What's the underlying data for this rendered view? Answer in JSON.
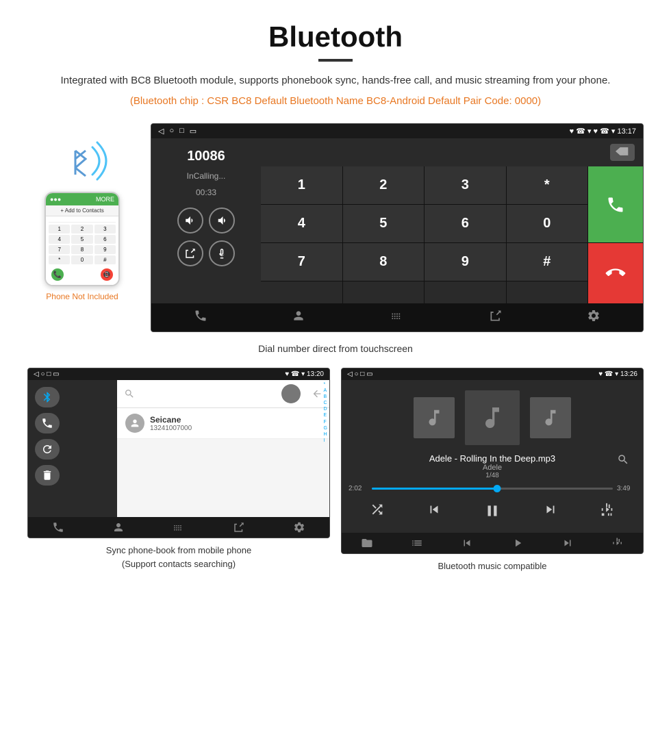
{
  "page": {
    "title": "Bluetooth",
    "underline": true,
    "description": "Integrated with BC8 Bluetooth module, supports phonebook sync, hands-free call, and music streaming from your phone.",
    "orange_info": "(Bluetooth chip : CSR BC8    Default Bluetooth Name BC8-Android    Default Pair Code: 0000)"
  },
  "phone_illustration": {
    "not_included_label": "Phone Not Included"
  },
  "android_screen": {
    "status_bar": {
      "left_icons": "◁  ○  □  ▭",
      "right": "♥ ☎ ▾ 13:17"
    },
    "call": {
      "number": "10086",
      "status": "InCalling...",
      "timer": "00:33"
    },
    "numpad": {
      "display_number": "10086",
      "keys": [
        "1",
        "2",
        "3",
        "*",
        "4",
        "5",
        "6",
        "0",
        "7",
        "8",
        "9",
        "#"
      ]
    }
  },
  "caption_dial": "Dial number direct from touchscreen",
  "phonebook_screen": {
    "status_bar": {
      "left": "◁  ○  □  ▭",
      "right": "♥ ☎ ▾ 13:20"
    },
    "contact_name": "Seicane",
    "contact_number": "13241007000",
    "alphabet": [
      "*",
      "A",
      "B",
      "C",
      "D",
      "E",
      "F",
      "G",
      "H",
      "I"
    ],
    "search_placeholder": "Search"
  },
  "music_screen": {
    "status_bar": {
      "left": "◁  ○  □  ▭",
      "right": "♥ ☎ ▾ 13:26"
    },
    "song_title": "Adele - Rolling In the Deep.mp3",
    "artist": "Adele",
    "track_num": "1/48",
    "time_current": "2:02",
    "time_total": "3:49",
    "progress_percent": 52
  },
  "captions": {
    "phonebook": "Sync phone-book from mobile phone\n(Support contacts searching)",
    "music": "Bluetooth music compatible"
  },
  "icons": {
    "bluetooth": "⚡",
    "phone": "📞",
    "back": "◁",
    "home": "○",
    "recents": "□",
    "volume_up": "🔊",
    "volume_down": "🔉",
    "transfer": "⇄",
    "mic": "🎤",
    "call_green": "📞",
    "call_red": "📵",
    "search": "🔍",
    "contacts": "👤",
    "dialpad": "⠿",
    "settings": "⚙",
    "shuffle": "⇄",
    "prev": "⏮",
    "play": "⏸",
    "next": "⏭",
    "equalizer": "🎚",
    "folder": "📁",
    "playlist": "☰"
  }
}
